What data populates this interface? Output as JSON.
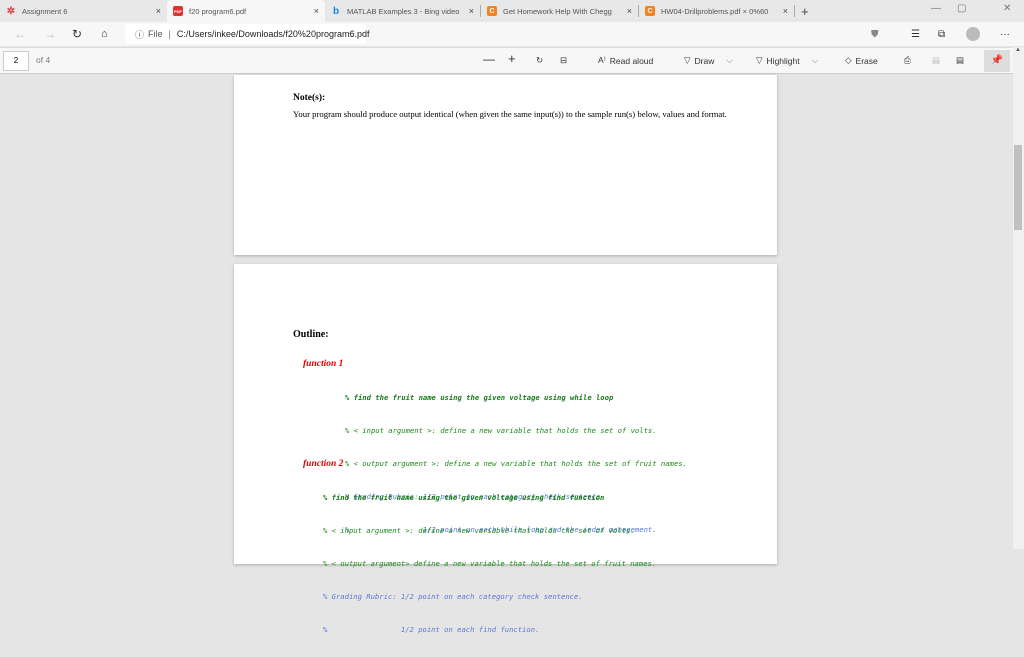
{
  "tabs": [
    {
      "label": "Assignment 6",
      "icon": "canvas-icon",
      "color": "#e03a3a"
    },
    {
      "label": "f20 program6.pdf",
      "icon": "pdf-icon",
      "color": "#d33"
    },
    {
      "label": "MATLAB Examples 3 - Bing video",
      "icon": "bing-icon",
      "color": "#1e88e5"
    },
    {
      "label": "Get Homework Help With Chegg",
      "icon": "chegg-icon",
      "color": "#f5821f"
    },
    {
      "label": "HW04-Drillproblems.pdf × 0%60",
      "icon": "chegg-icon",
      "color": "#f5821f"
    }
  ],
  "address": {
    "scheme": "File",
    "url": "C:/Users/inkee/Downloads/f20%20program6.pdf"
  },
  "pdf_toolbar": {
    "page": "2",
    "of": "of 4",
    "read_aloud": "Read aloud",
    "draw": "Draw",
    "highlight": "Highlight",
    "erase": "Erase"
  },
  "page1": {
    "heading": "Note(s):",
    "body": "Your program should produce output identical (when given the same input(s)) to the sample run(s) below, values and format."
  },
  "page2": {
    "heading": "Outline:",
    "f1": {
      "title": "function 1",
      "lines": [
        "% find the fruit name using the given voltage using while loop",
        "% < input argument >: define a new variable that holds the set of volts.",
        "% < output argument >: define a new variable that holds the set of fruit names.",
        "% Grading Rubric: 1/2 point on each category check sentence",
        "%                 1/2 point on each while loop and the index management."
      ]
    },
    "f2": {
      "title": "function 2",
      "lines": [
        "% find the fruit name using the given voltage using find function",
        "% < input argument >: define a new variable that holds the set of volts.",
        "% < output argument> define a new variable that holds the set of fruit names.",
        "% Grading Rubric: 1/2 point on each category check sentence.",
        "%                 1/2 point on each find function."
      ]
    }
  }
}
